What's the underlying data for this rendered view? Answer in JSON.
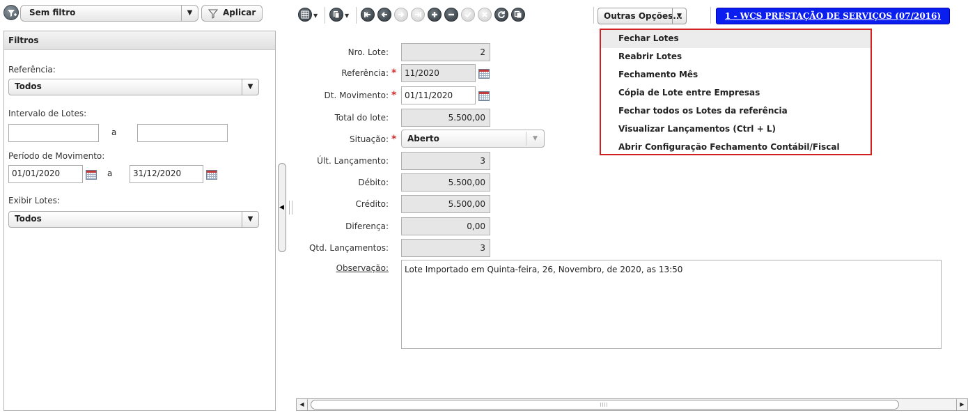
{
  "filter_bar": {
    "selected_filter": "Sem filtro",
    "apply_label": "Aplicar",
    "filter_icon": "filter-add-icon"
  },
  "filters_panel": {
    "title": "Filtros",
    "referencia": {
      "label": "Referência:",
      "value": "Todos"
    },
    "intervalo_lotes": {
      "label": "Intervalo de Lotes:",
      "from": "",
      "separator": "a",
      "to": ""
    },
    "periodo_movimento": {
      "label": "Período de Movimento:",
      "from": "01/01/2020",
      "separator": "a",
      "to": "31/12/2020"
    },
    "exibir_lotes": {
      "label": "Exibir Lotes:",
      "value": "Todos"
    }
  },
  "toolbar": {
    "icons": [
      "grid-view-icon",
      "copy-icon",
      "first-record-icon",
      "previous-record-icon",
      "next-record-icon",
      "last-record-icon",
      "add-icon",
      "remove-icon",
      "confirm-icon",
      "cancel-icon",
      "refresh-icon",
      "duplicate-icon"
    ],
    "more_options_label": "Outras Opções...",
    "company_label": "1 - WCS PRESTAÇÃO DE SERVIÇOS (07/2016)"
  },
  "form": {
    "nro_lote": {
      "label": "Nro. Lote:",
      "value": "2"
    },
    "referencia": {
      "label": "Referência:",
      "value": "11/2020"
    },
    "dt_movimento": {
      "label": "Dt. Movimento:",
      "value": "01/11/2020"
    },
    "total_lote": {
      "label": "Total do lote:",
      "value": "5.500,00"
    },
    "situacao": {
      "label": "Situação:",
      "value": "Aberto"
    },
    "ult_lancamento": {
      "label": "Últ. Lançamento:",
      "value": "3"
    },
    "debito": {
      "label": "Débito:",
      "value": "5.500,00"
    },
    "credito": {
      "label": "Crédito:",
      "value": "5.500,00"
    },
    "diferenca": {
      "label": "Diferença:",
      "value": "0,00"
    },
    "qtd_lancamentos": {
      "label": "Qtd. Lançamentos:",
      "value": "3"
    },
    "observacao": {
      "label": "Observação:",
      "value": "Lote Importado em Quinta-feira, 26, Novembro, de 2020, as  13:50"
    },
    "required_mark": "*"
  },
  "menu": {
    "items": [
      "Fechar Lotes",
      "Reabrir Lotes",
      "Fechamento Mês",
      "Cópia de Lote entre Empresas",
      "Fechar todos os Lotes da referência",
      "Visualizar Lançamentos (Ctrl + L)",
      "Abrir Configuração Fechamento Contábil/Fiscal"
    ],
    "highlight_color": "#d02020"
  },
  "colors": {
    "company_button": "#0a1ef0",
    "required": "#d43030",
    "readonly_bg": "#e6e6e6"
  }
}
